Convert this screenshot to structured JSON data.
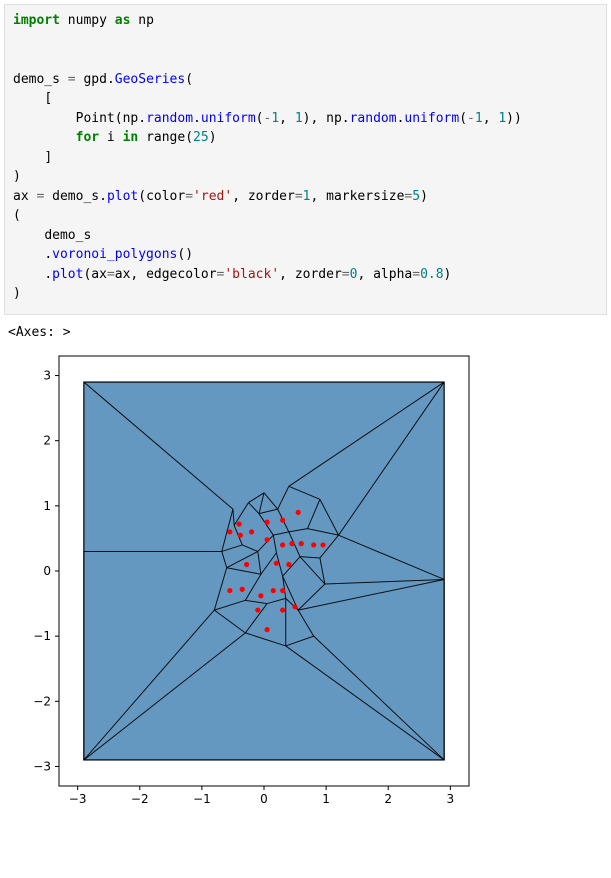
{
  "code": {
    "import_kw": "import",
    "numpy": "numpy",
    "as_kw": "as",
    "np": "np",
    "demo_s": "demo_s",
    "eq": " = ",
    "gpd": "gpd",
    "dot": ".",
    "GeoSeries": "GeoSeries",
    "lpar": "(",
    "rpar": ")",
    "lbracket": "[",
    "rbracket": "]",
    "Point": "Point",
    "random": "random",
    "uniform": "uniform",
    "neg1": "-1",
    "one": "1",
    "comma_sp": ", ",
    "for_kw": "for",
    "i": " i ",
    "in_kw": "in",
    "range": " range",
    "twentyfive": "25",
    "ax": "ax",
    "plot": "plot",
    "color_kw": "color",
    "red_str": "'red'",
    "zorder_kw": "zorder",
    "markersize_kw": "markersize",
    "five": "5",
    "voronoi": "voronoi_polygons",
    "ax_kw": "ax",
    "edgecolor_kw": "edgecolor",
    "black_str": "'black'",
    "zero": "0",
    "alpha_kw": "alpha",
    "pt8": "0.8",
    "indent4": "    ",
    "indent8": "        "
  },
  "output": "<Axes: >",
  "chart_data": {
    "type": "scatter",
    "xlim": [
      -3.3,
      3.3
    ],
    "ylim": [
      -3.3,
      3.3
    ],
    "xticks": [
      -3,
      -2,
      -1,
      0,
      1,
      2,
      3
    ],
    "yticks": [
      -3,
      -2,
      -1,
      0,
      1,
      2,
      3
    ],
    "xtick_labels": [
      "−3",
      "−2",
      "−1",
      "0",
      "1",
      "2",
      "3"
    ],
    "ytick_labels": [
      "−3",
      "−2",
      "−1",
      "0",
      "1",
      "2",
      "3"
    ],
    "background_fill": "#3e7eb1",
    "edge_color": "#000000",
    "point_color": "#ff0000",
    "points": [
      [
        -0.55,
        0.6
      ],
      [
        -0.4,
        0.72
      ],
      [
        -0.38,
        0.55
      ],
      [
        -0.2,
        0.6
      ],
      [
        0.05,
        0.48
      ],
      [
        0.05,
        0.75
      ],
      [
        0.3,
        0.78
      ],
      [
        0.55,
        0.9
      ],
      [
        0.3,
        0.4
      ],
      [
        0.45,
        0.42
      ],
      [
        0.6,
        0.42
      ],
      [
        0.8,
        0.4
      ],
      [
        0.95,
        0.4
      ],
      [
        -0.28,
        0.1
      ],
      [
        0.2,
        0.12
      ],
      [
        0.4,
        0.1
      ],
      [
        -0.55,
        -0.3
      ],
      [
        -0.35,
        -0.28
      ],
      [
        -0.05,
        -0.38
      ],
      [
        0.15,
        -0.3
      ],
      [
        0.3,
        -0.3
      ],
      [
        0.5,
        -0.55
      ],
      [
        0.3,
        -0.6
      ],
      [
        -0.1,
        -0.6
      ],
      [
        0.05,
        -0.9
      ]
    ],
    "voronoi_vertices": [
      [
        -2.9,
        -2.9
      ],
      [
        2.9,
        -2.9
      ],
      [
        2.9,
        2.9
      ],
      [
        -2.9,
        2.9
      ],
      [
        -2.9,
        0.3
      ],
      [
        -0.68,
        0.3
      ],
      [
        -0.5,
        0.95
      ],
      [
        -0.25,
        1.05
      ],
      [
        0.0,
        1.2
      ],
      [
        0.4,
        1.3
      ],
      [
        0.9,
        1.1
      ],
      [
        1.2,
        0.55
      ],
      [
        2.9,
        -0.13
      ],
      [
        0.98,
        -0.2
      ],
      [
        0.55,
        -0.6
      ],
      [
        0.8,
        -1.0
      ],
      [
        0.35,
        -1.15
      ],
      [
        -0.3,
        -0.95
      ],
      [
        -0.8,
        -0.6
      ],
      [
        -0.6,
        0.05
      ],
      [
        -0.35,
        0.4
      ],
      [
        -0.1,
        0.3
      ],
      [
        0.15,
        0.55
      ],
      [
        0.4,
        0.6
      ],
      [
        0.58,
        0.22
      ],
      [
        0.3,
        -0.08
      ],
      [
        -0.05,
        -0.05
      ],
      [
        -0.3,
        -0.45
      ],
      [
        0.05,
        -0.5
      ],
      [
        0.35,
        -0.42
      ],
      [
        -0.48,
        0.7
      ],
      [
        -0.08,
        0.88
      ],
      [
        0.22,
        0.95
      ],
      [
        0.7,
        0.65
      ],
      [
        0.9,
        0.2
      ],
      [
        0.2,
        0.28
      ]
    ],
    "voronoi_edges": [
      [
        0,
        4
      ],
      [
        4,
        5
      ],
      [
        5,
        6
      ],
      [
        6,
        3
      ],
      [
        3,
        2
      ],
      [
        6,
        30
      ],
      [
        30,
        7
      ],
      [
        7,
        8
      ],
      [
        8,
        31
      ],
      [
        31,
        32
      ],
      [
        32,
        9
      ],
      [
        9,
        2
      ],
      [
        9,
        10
      ],
      [
        10,
        11
      ],
      [
        11,
        2
      ],
      [
        11,
        12
      ],
      [
        12,
        1
      ],
      [
        5,
        19
      ],
      [
        19,
        18
      ],
      [
        18,
        0
      ],
      [
        18,
        17
      ],
      [
        17,
        0
      ],
      [
        17,
        16
      ],
      [
        16,
        1
      ],
      [
        16,
        15
      ],
      [
        15,
        1
      ],
      [
        15,
        14
      ],
      [
        14,
        12
      ],
      [
        14,
        13
      ],
      [
        13,
        12
      ],
      [
        5,
        20
      ],
      [
        20,
        30
      ],
      [
        20,
        21
      ],
      [
        21,
        19
      ],
      [
        21,
        26
      ],
      [
        26,
        19
      ],
      [
        26,
        27
      ],
      [
        27,
        18
      ],
      [
        27,
        28
      ],
      [
        28,
        17
      ],
      [
        28,
        29
      ],
      [
        29,
        16
      ],
      [
        29,
        25
      ],
      [
        25,
        14
      ],
      [
        25,
        24
      ],
      [
        24,
        13
      ],
      [
        24,
        34
      ],
      [
        34,
        13
      ],
      [
        34,
        11
      ],
      [
        24,
        23
      ],
      [
        23,
        33
      ],
      [
        33,
        10
      ],
      [
        33,
        11
      ],
      [
        23,
        22
      ],
      [
        22,
        31
      ],
      [
        22,
        35
      ],
      [
        35,
        25
      ],
      [
        35,
        26
      ],
      [
        21,
        22
      ],
      [
        7,
        31
      ],
      [
        8,
        32
      ],
      [
        32,
        23
      ],
      [
        29,
        14
      ]
    ]
  }
}
